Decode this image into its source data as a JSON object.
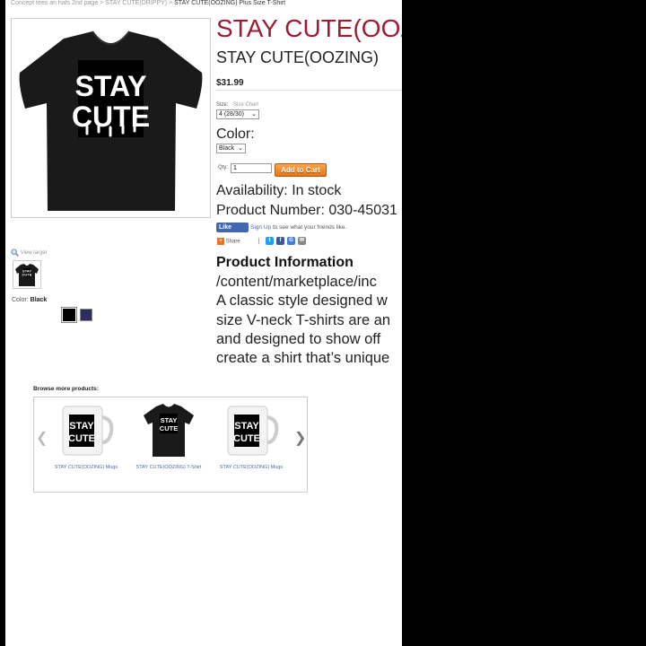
{
  "breadcrumb": {
    "items": [
      "Concept tees an hats 2nd page",
      "STAY CUTE(DRIPPY)"
    ],
    "separator": ">",
    "current": "STAY CUTE(OOZING) Plus Size T-Shirt"
  },
  "product": {
    "title": "STAY CUTE(OOZING) Plus Size T-Shirt",
    "subtitle": "STAY CUTE(OOZING)",
    "price": "$31.99",
    "size_label": "Size:",
    "size_chart_link": "Size Chart",
    "size_value": "4 (28/30)",
    "color_title": "Color:",
    "color_value": "Black",
    "qty_label": "Qty:",
    "qty_value": "1",
    "add_to_cart": "Add to Cart",
    "availability": "Availability: In stock",
    "product_number": "Product Number: 030-45031",
    "shirt_print_lines": [
      "STAY",
      "CUTE"
    ],
    "shirt_color": "#1a1a1a",
    "title_color": "#9e1b32"
  },
  "social": {
    "like_label": "Like",
    "signup_label": "Sign Up",
    "like_text": "to see what your friends like.",
    "share_label": "Share"
  },
  "info": {
    "heading": "Product Information",
    "lines": [
      "/content/marketplace/inc",
      "A classic style designed w",
      "size V-neck T-shirts are an",
      "and designed to show off",
      "create a shirt that’s unique"
    ]
  },
  "gallery": {
    "view_larger": "View larger",
    "color_label": "Color:",
    "color_value": "Black",
    "swatches": [
      "#000000",
      "#2e2d5e"
    ]
  },
  "browse": {
    "title": "Browse more products:",
    "items": [
      {
        "label": "STAY CUTE(OOZING) Mugs",
        "kind": "mug"
      },
      {
        "label": "STAY CUTE(OOZING) T-Shirt",
        "kind": "shirt"
      },
      {
        "label": "STAY CUTE(OOZING) Mugs",
        "kind": "mug"
      }
    ]
  }
}
